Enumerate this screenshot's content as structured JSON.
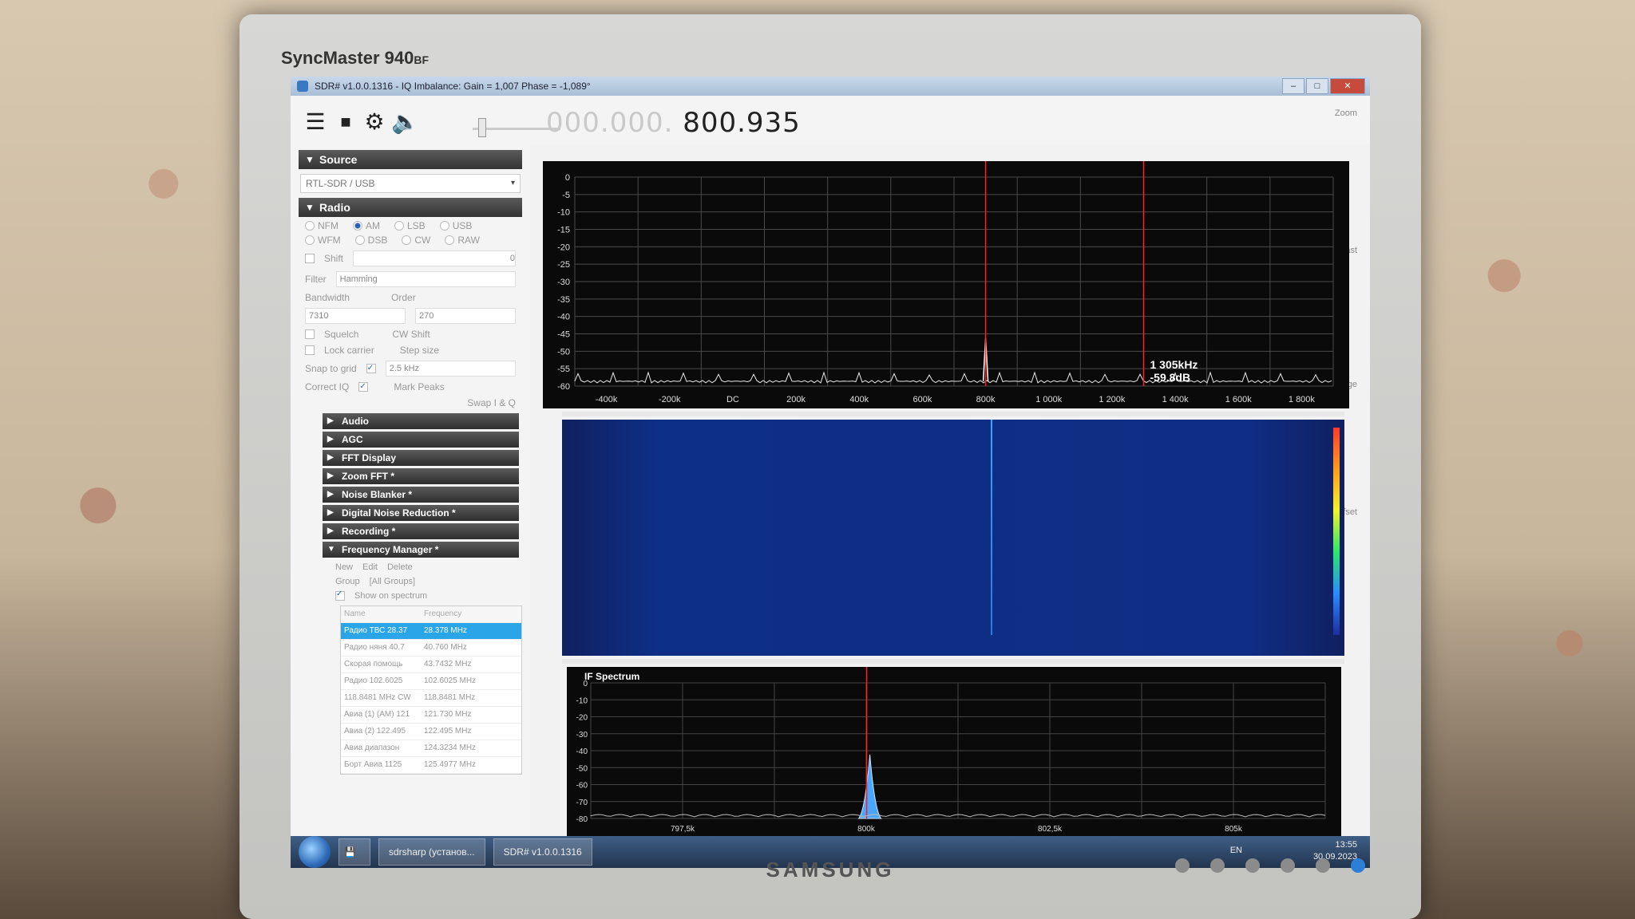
{
  "monitor": {
    "model": "SyncMaster 940",
    "model_suffix": "BF",
    "maker": "SAMSUNG"
  },
  "window": {
    "title": "SDR# v1.0.0.1316 - IQ Imbalance: Gain = 1,007 Phase = -1,089°",
    "min": "–",
    "max": "□",
    "close": "✕"
  },
  "toolbar": {
    "menu_icon": "menu-icon",
    "stop_icon": "stop-icon",
    "settings_icon": "gear-icon",
    "audio_icon": "speaker-icon",
    "freq_dim": "000.000.",
    "freq_lit": "800.935"
  },
  "right_labels": {
    "zoom": "Zoom",
    "contrast": "Contrast",
    "range": "Range",
    "offset": "Offset"
  },
  "sidebar": {
    "source": {
      "header": "Source",
      "device": "RTL-SDR / USB"
    },
    "radio": {
      "header": "Radio",
      "modes_row1": [
        "NFM",
        "AM",
        "LSB",
        "USB"
      ],
      "modes_row2": [
        "WFM",
        "DSB",
        "CW",
        "RAW"
      ],
      "selected_mode": "AM",
      "shift_label": "Shift",
      "shift_value": "0",
      "filter_label": "Filter",
      "filter_value": "Hamming",
      "bandwidth_label": "Bandwidth",
      "order_label": "Order",
      "bandwidth_value": "7310",
      "order_value": "270",
      "squelch_label": "Squelch",
      "cw_shift_label": "CW Shift",
      "lock_carrier_label": "Lock carrier",
      "step_size_label": "Step size",
      "snap_label": "Snap to grid",
      "step_value": "2.5 kHz",
      "correct_iq_label": "Correct IQ",
      "mark_peaks_label": "Mark Peaks",
      "swap_label": "Swap I & Q"
    },
    "collapsed_panels": [
      "Audio",
      "AGC",
      "FFT Display",
      "Zoom FFT *",
      "Noise Blanker *",
      "Digital Noise Reduction *",
      "Recording *"
    ],
    "frequency_manager": {
      "header": "Frequency Manager *",
      "new": "New",
      "edit": "Edit",
      "delete": "Delete",
      "group_label": "Group",
      "group_value": "[All Groups]",
      "show_on_spectrum": "Show on spectrum",
      "col_name": "Name",
      "col_freq": "Frequency",
      "rows": [
        {
          "name": "Радио ТВС 28.37",
          "freq": "28.378 MHz"
        },
        {
          "name": "Радио няня 40.7",
          "freq": "40.760 MHz"
        },
        {
          "name": "Скорая помощь",
          "freq": "43.7432 MHz"
        },
        {
          "name": "Радио 102.6025",
          "freq": "102.6025 MHz"
        },
        {
          "name": "118.8481 MHz CW",
          "freq": "118.8481 MHz"
        },
        {
          "name": "Авиа (1) (АМ) 121",
          "freq": "121.730 MHz"
        },
        {
          "name": "Авиа (2) 122.495",
          "freq": "122.495 MHz"
        },
        {
          "name": "Авиа диапазон",
          "freq": "124.3234 MHz"
        },
        {
          "name": "Борт Авиа 1125",
          "freq": "125.4977 MHz"
        }
      ],
      "selected_index": 0
    }
  },
  "spectrum": {
    "y_ticks": [
      "0",
      "-5",
      "-10",
      "-15",
      "-20",
      "-25",
      "-30",
      "-35",
      "-40",
      "-45",
      "-50",
      "-55",
      "-60"
    ],
    "x_ticks": [
      "-400k",
      "-200k",
      "DC",
      "200k",
      "400k",
      "600k",
      "800k",
      "1 000k",
      "1 200k",
      "1 400k",
      "1 600k",
      "1 800k"
    ],
    "cursor_freq": "1 305kHz",
    "cursor_level": "-59.8dB",
    "peak_center": "800k"
  },
  "if_spectrum": {
    "title": "IF Spectrum",
    "y_ticks": [
      "0",
      "-10",
      "-20",
      "-30",
      "-40",
      "-50",
      "-60",
      "-70",
      "-80"
    ],
    "x_ticks": [
      "797,5k",
      "800k",
      "802,5k",
      "805k"
    ]
  },
  "taskbar": {
    "items": [
      "sdrsharp (установ...",
      "SDR# v1.0.0.1316"
    ],
    "lang": "EN",
    "time": "13:55",
    "date": "30.09.2023"
  },
  "colors": {
    "accent_selected": "#2aa6e8",
    "waterfall_bg": "#0f2d84",
    "cursor_red": "#ff2020"
  }
}
